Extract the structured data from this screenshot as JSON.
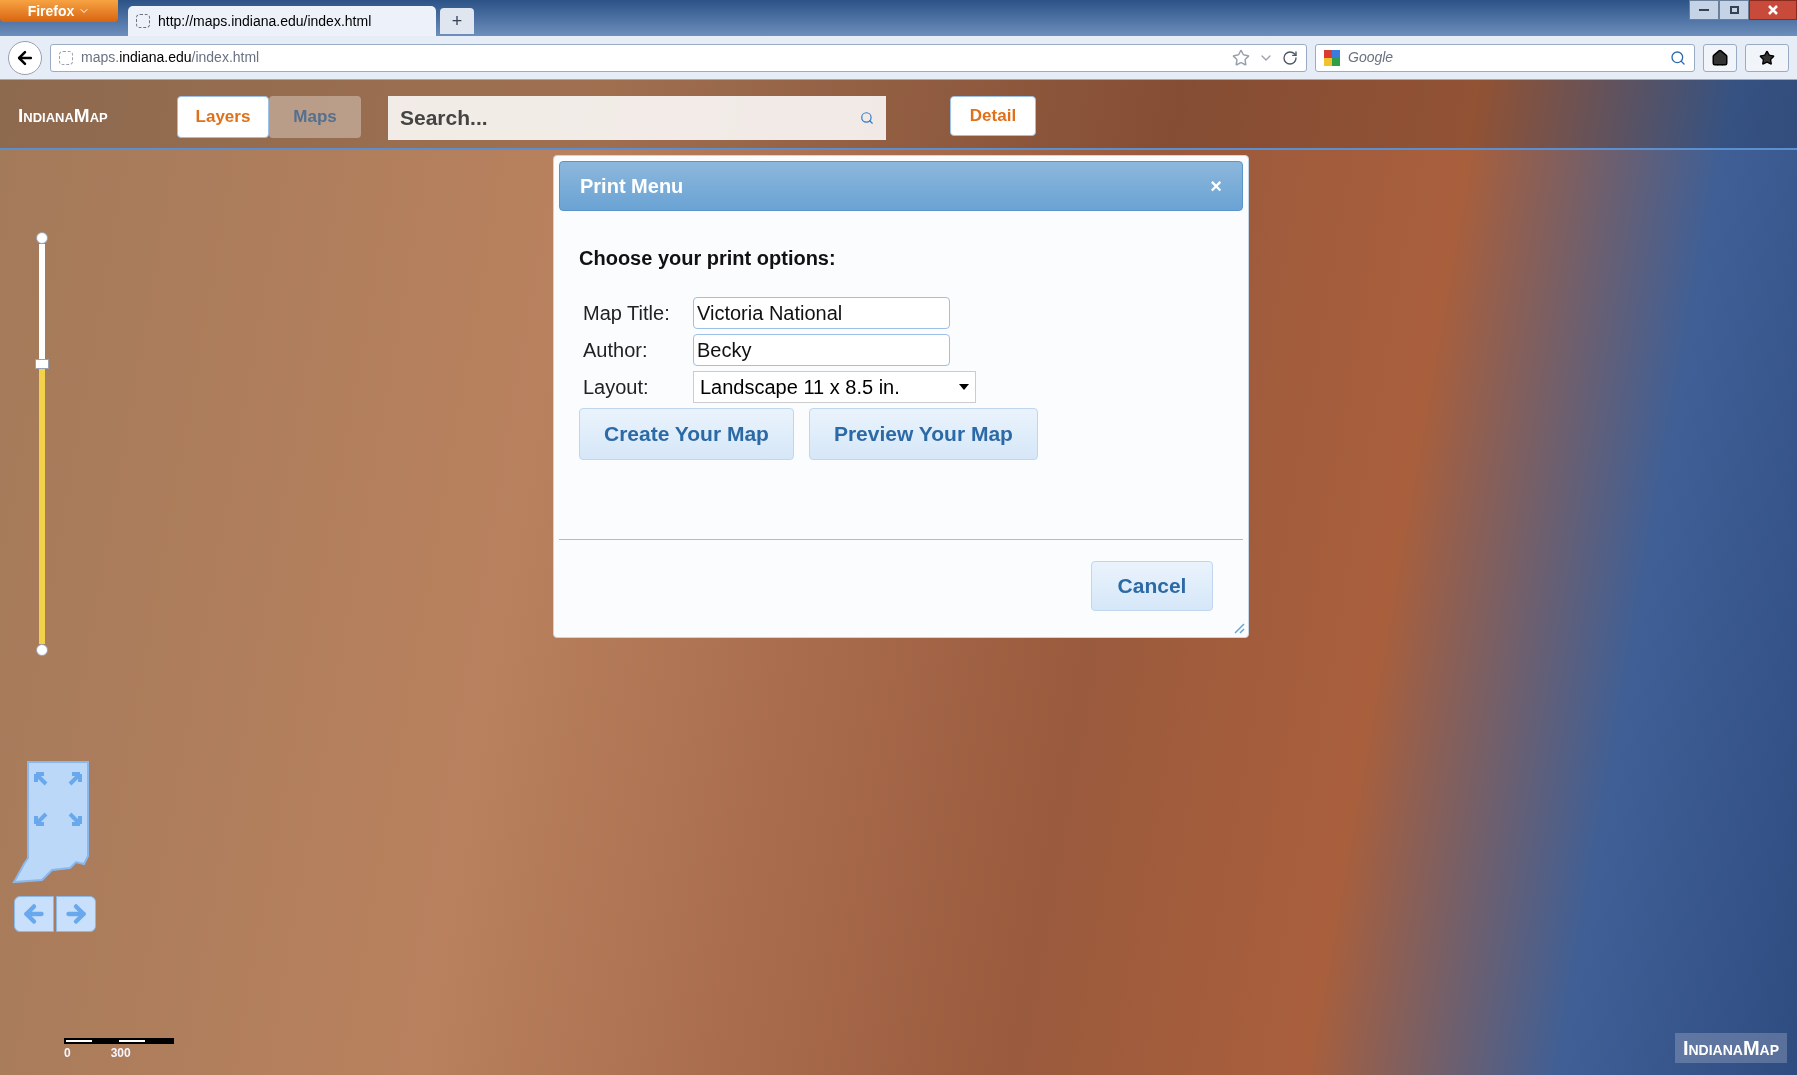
{
  "browser": {
    "menu_button": "Firefox",
    "tabs": [
      {
        "title": "http://maps.indiana.edu/index.html",
        "selected": true
      }
    ],
    "new_tab": "+",
    "url": "maps.**indiana.edu**/index.html",
    "search_engine": "Google"
  },
  "app": {
    "logo": "IndianaMap",
    "tabs": [
      {
        "label": "Layers",
        "selected": true
      },
      {
        "label": "Maps",
        "selected": false
      }
    ],
    "search": {
      "placeholder": "Search..."
    },
    "detail_button": "Detail"
  },
  "zoom_slider": {
    "level": 0.7
  },
  "scale": {
    "labels": [
      "0",
      "300"
    ]
  },
  "dialog": {
    "title": "Print Menu",
    "close": "×",
    "heading": "Choose your print options:",
    "fields": [
      {
        "label": "Map Title:",
        "kind": "text",
        "value": "Victoria National"
      },
      {
        "label": "Author:",
        "kind": "text",
        "value": "Becky"
      },
      {
        "label": "Layout:",
        "kind": "select",
        "value": "Landscape 11 x 8.5 in."
      }
    ],
    "buttons": [
      "Create Your Map",
      "Preview Your Map"
    ],
    "cancel": "Cancel"
  },
  "footer_logo": "IndianaMap"
}
